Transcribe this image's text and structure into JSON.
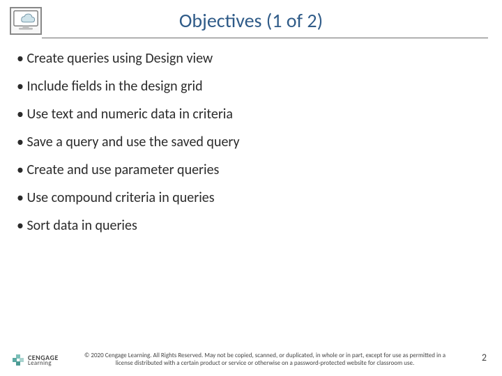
{
  "title": "Objectives (1 of 2)",
  "icon": "cloud-monitor-icon",
  "bullets": [
    "Create queries using Design view",
    "Include fields in the design grid",
    "Use text and numeric data in criteria",
    "Save a query and use the saved query",
    "Create and use parameter queries",
    "Use compound criteria in queries",
    "Sort data in queries"
  ],
  "logo": {
    "brand": "CENGAGE",
    "sub": "Learning"
  },
  "copyright": "© 2020 Cengage Learning. All Rights Reserved. May not be copied, scanned, or duplicated, in whole or in part, except for use as permitted in a license distributed with a certain product or service or otherwise on a password-protected website for classroom use.",
  "page": "2"
}
